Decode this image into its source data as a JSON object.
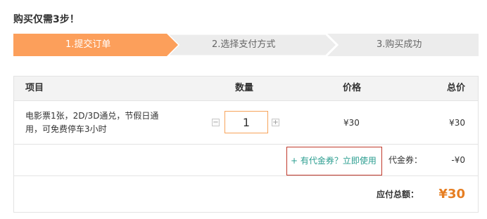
{
  "page_title": "购买仅需3步！",
  "steps": [
    {
      "label": "1.提交订单",
      "active": true
    },
    {
      "label": "2.选择支付方式",
      "active": false
    },
    {
      "label": "3.购买成功",
      "active": false
    }
  ],
  "colors": {
    "step_active": "#fc9f5b",
    "step_inactive": "#ececec",
    "accent": "#e67e22",
    "link": "#2a9d8f",
    "highlight_box": "#c0392b"
  },
  "table": {
    "headers": {
      "item": "项目",
      "quantity": "数量",
      "price": "价格",
      "total": "总价"
    },
    "item": {
      "description": "电影票1张，2D/3D通兑，节假日通用，可免费停车3小时",
      "minus": "−",
      "quantity": "1",
      "plus": "+",
      "unit_price": "¥30",
      "total_price": "¥30"
    },
    "coupon": {
      "link": "+ 有代金券？立即使用",
      "label": "代金券：",
      "value": "-¥0"
    },
    "summary": {
      "label": "应付总额：",
      "value": "¥30"
    }
  }
}
